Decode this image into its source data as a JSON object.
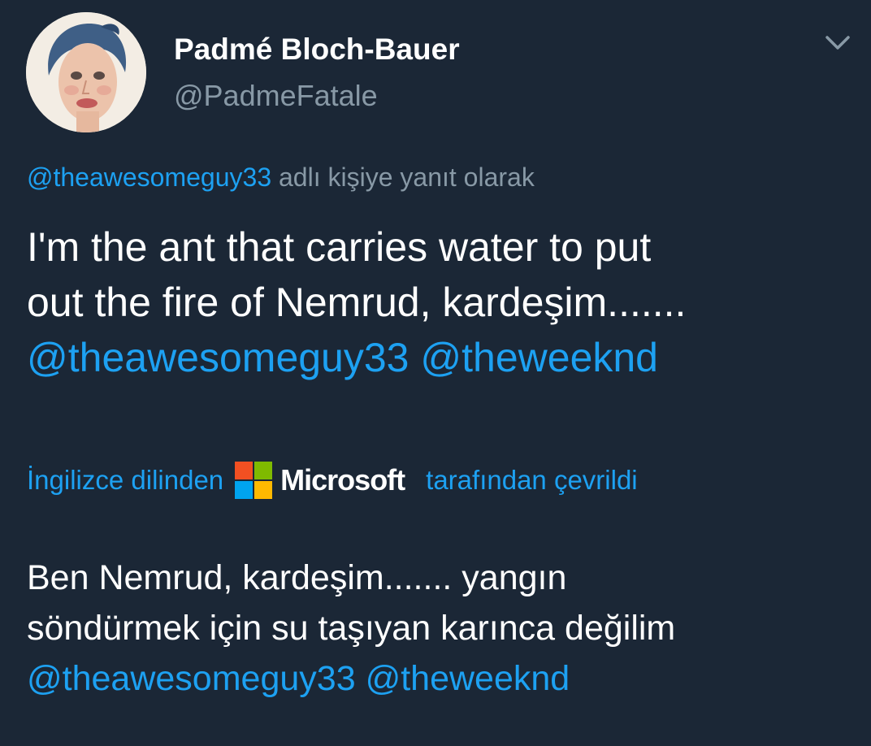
{
  "author": {
    "display_name": "Padmé Bloch-Bauer",
    "handle": "@PadmeFatale"
  },
  "reply_context": {
    "mention": "@theawesomeguy33",
    "suffix": "adlı kişiye yanıt olarak"
  },
  "tweet": {
    "line1": "I'm the ant that carries water to put",
    "line2": "out the fire of Nemrud, kardeşim.......",
    "mention1": "@theawesomeguy33",
    "mention2": "@theweeknd"
  },
  "translation_note": {
    "prefix": "İngilizce dilinden",
    "brand": "Microsoft",
    "suffix": "tarafından çevrildi"
  },
  "translated": {
    "line1": "Ben Nemrud, kardeşim....... yangın",
    "line2": "söndürmek için su taşıyan karınca değilim",
    "mention1": "@theawesomeguy33",
    "mention2": "@theweeknd"
  },
  "icons": {
    "menu": "chevron-down-icon",
    "brand_logo": "microsoft-logo-icon"
  },
  "colors": {
    "background": "#1b2736",
    "link": "#1da1f2",
    "muted": "#8899a6",
    "text": "#ffffff",
    "ms_red": "#f25022",
    "ms_green": "#7fba00",
    "ms_blue": "#00a4ef",
    "ms_yellow": "#ffb900"
  }
}
